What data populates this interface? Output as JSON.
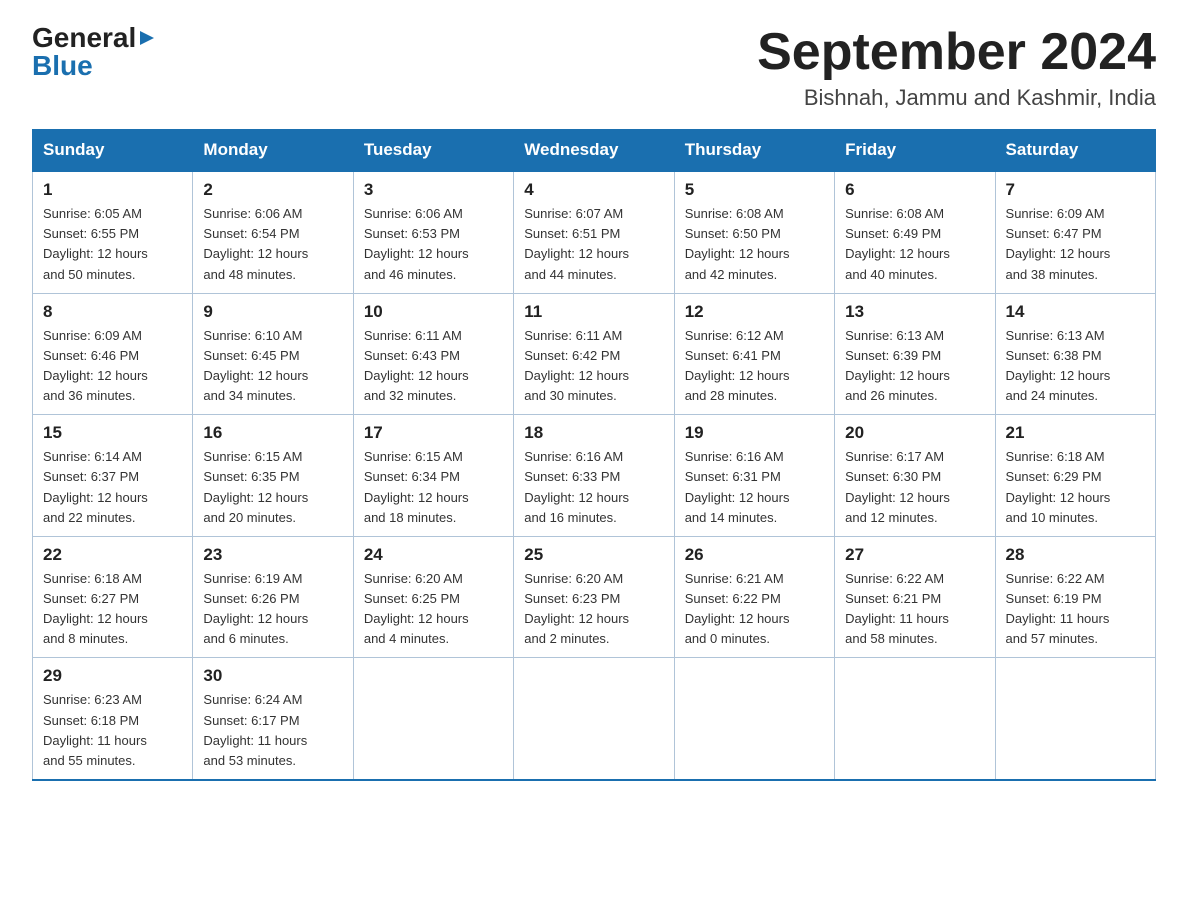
{
  "header": {
    "logo": {
      "general": "General",
      "blue": "Blue",
      "arrow": "▶"
    },
    "title": "September 2024",
    "location": "Bishnah, Jammu and Kashmir, India"
  },
  "calendar": {
    "days_of_week": [
      "Sunday",
      "Monday",
      "Tuesday",
      "Wednesday",
      "Thursday",
      "Friday",
      "Saturday"
    ],
    "weeks": [
      [
        {
          "day": "1",
          "sunrise": "6:05 AM",
          "sunset": "6:55 PM",
          "daylight": "12 hours and 50 minutes."
        },
        {
          "day": "2",
          "sunrise": "6:06 AM",
          "sunset": "6:54 PM",
          "daylight": "12 hours and 48 minutes."
        },
        {
          "day": "3",
          "sunrise": "6:06 AM",
          "sunset": "6:53 PM",
          "daylight": "12 hours and 46 minutes."
        },
        {
          "day": "4",
          "sunrise": "6:07 AM",
          "sunset": "6:51 PM",
          "daylight": "12 hours and 44 minutes."
        },
        {
          "day": "5",
          "sunrise": "6:08 AM",
          "sunset": "6:50 PM",
          "daylight": "12 hours and 42 minutes."
        },
        {
          "day": "6",
          "sunrise": "6:08 AM",
          "sunset": "6:49 PM",
          "daylight": "12 hours and 40 minutes."
        },
        {
          "day": "7",
          "sunrise": "6:09 AM",
          "sunset": "6:47 PM",
          "daylight": "12 hours and 38 minutes."
        }
      ],
      [
        {
          "day": "8",
          "sunrise": "6:09 AM",
          "sunset": "6:46 PM",
          "daylight": "12 hours and 36 minutes."
        },
        {
          "day": "9",
          "sunrise": "6:10 AM",
          "sunset": "6:45 PM",
          "daylight": "12 hours and 34 minutes."
        },
        {
          "day": "10",
          "sunrise": "6:11 AM",
          "sunset": "6:43 PM",
          "daylight": "12 hours and 32 minutes."
        },
        {
          "day": "11",
          "sunrise": "6:11 AM",
          "sunset": "6:42 PM",
          "daylight": "12 hours and 30 minutes."
        },
        {
          "day": "12",
          "sunrise": "6:12 AM",
          "sunset": "6:41 PM",
          "daylight": "12 hours and 28 minutes."
        },
        {
          "day": "13",
          "sunrise": "6:13 AM",
          "sunset": "6:39 PM",
          "daylight": "12 hours and 26 minutes."
        },
        {
          "day": "14",
          "sunrise": "6:13 AM",
          "sunset": "6:38 PM",
          "daylight": "12 hours and 24 minutes."
        }
      ],
      [
        {
          "day": "15",
          "sunrise": "6:14 AM",
          "sunset": "6:37 PM",
          "daylight": "12 hours and 22 minutes."
        },
        {
          "day": "16",
          "sunrise": "6:15 AM",
          "sunset": "6:35 PM",
          "daylight": "12 hours and 20 minutes."
        },
        {
          "day": "17",
          "sunrise": "6:15 AM",
          "sunset": "6:34 PM",
          "daylight": "12 hours and 18 minutes."
        },
        {
          "day": "18",
          "sunrise": "6:16 AM",
          "sunset": "6:33 PM",
          "daylight": "12 hours and 16 minutes."
        },
        {
          "day": "19",
          "sunrise": "6:16 AM",
          "sunset": "6:31 PM",
          "daylight": "12 hours and 14 minutes."
        },
        {
          "day": "20",
          "sunrise": "6:17 AM",
          "sunset": "6:30 PM",
          "daylight": "12 hours and 12 minutes."
        },
        {
          "day": "21",
          "sunrise": "6:18 AM",
          "sunset": "6:29 PM",
          "daylight": "12 hours and 10 minutes."
        }
      ],
      [
        {
          "day": "22",
          "sunrise": "6:18 AM",
          "sunset": "6:27 PM",
          "daylight": "12 hours and 8 minutes."
        },
        {
          "day": "23",
          "sunrise": "6:19 AM",
          "sunset": "6:26 PM",
          "daylight": "12 hours and 6 minutes."
        },
        {
          "day": "24",
          "sunrise": "6:20 AM",
          "sunset": "6:25 PM",
          "daylight": "12 hours and 4 minutes."
        },
        {
          "day": "25",
          "sunrise": "6:20 AM",
          "sunset": "6:23 PM",
          "daylight": "12 hours and 2 minutes."
        },
        {
          "day": "26",
          "sunrise": "6:21 AM",
          "sunset": "6:22 PM",
          "daylight": "12 hours and 0 minutes."
        },
        {
          "day": "27",
          "sunrise": "6:22 AM",
          "sunset": "6:21 PM",
          "daylight": "11 hours and 58 minutes."
        },
        {
          "day": "28",
          "sunrise": "6:22 AM",
          "sunset": "6:19 PM",
          "daylight": "11 hours and 57 minutes."
        }
      ],
      [
        {
          "day": "29",
          "sunrise": "6:23 AM",
          "sunset": "6:18 PM",
          "daylight": "11 hours and 55 minutes."
        },
        {
          "day": "30",
          "sunrise": "6:24 AM",
          "sunset": "6:17 PM",
          "daylight": "11 hours and 53 minutes."
        },
        null,
        null,
        null,
        null,
        null
      ]
    ]
  }
}
